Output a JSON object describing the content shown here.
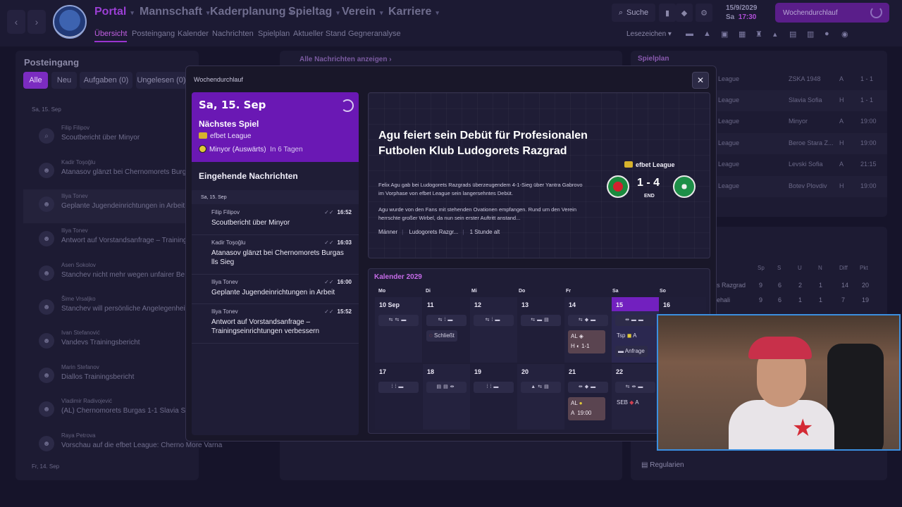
{
  "topbar": {
    "main_nav": [
      {
        "label": "Portal",
        "active": true
      },
      {
        "label": "Mannschaft"
      },
      {
        "label": "Kaderplanung"
      },
      {
        "label": "Spieltag"
      },
      {
        "label": "Verein"
      },
      {
        "label": "Karriere"
      }
    ],
    "sub_nav": [
      "Übersicht",
      "Posteingang",
      "Kalender",
      "Nachrichten",
      "Spielplan",
      "Aktueller Stand",
      "Gegneranalyse"
    ],
    "search_label": "Suche",
    "date": "15/9/2029",
    "day_time": "Sa",
    "time": "17:30",
    "continue_label": "Wochendurchlauf",
    "bookmarks_label": "Lesezeichen"
  },
  "inbox": {
    "title": "Posteingang",
    "filters": [
      "Alle",
      "Neu",
      "Aufgaben (0)",
      "Ungelesen (0)"
    ],
    "date_header": "Sa, 15. Sep",
    "date_header_2": "Fr, 14. Sep",
    "items": [
      {
        "sender": "Filip Filipov",
        "subject": "Scoutbericht über Minyor"
      },
      {
        "sender": "Kadir Toşoğlu",
        "subject": "Atanasov glänzt bei Chernomorets Burgas"
      },
      {
        "sender": "Iliya Tonev",
        "subject": "Geplante Jugendeinrichtungen in Arbeit"
      },
      {
        "sender": "Iliya Tonev",
        "subject": "Antwort auf Vorstandsanfrage – Training"
      },
      {
        "sender": "Asen Sokolov",
        "subject": "Stanchev nicht mehr wegen unfairer Be"
      },
      {
        "sender": "Šime Vrsaljko",
        "subject": "Stanchev will persönliche Angelegenheit"
      },
      {
        "sender": "Ivan Stefanović",
        "subject": "Vandevs Trainingsbericht"
      },
      {
        "sender": "Marin Stefanov",
        "subject": "Diallos Trainingsbericht"
      },
      {
        "sender": "Vladimir Radivojević",
        "subject": "(AL) Chernomorets Burgas 1-1 Slavia Sof"
      },
      {
        "sender": "Raya Petrova",
        "subject": "Vorschau auf die efbet League: Cherno More Varna vs. ZS..."
      }
    ]
  },
  "news_header": "Alle Nachrichten anzeigen",
  "schedule": {
    "title": "Spielplan",
    "rows": [
      {
        "comp": "League",
        "opponent": "ZSKA 1948",
        "venue": "A",
        "result": "1 - 1"
      },
      {
        "comp": "League",
        "opponent": "Slavia Sofia",
        "venue": "H",
        "result": "1 - 1"
      },
      {
        "comp": "League",
        "opponent": "Minyor",
        "venue": "A",
        "result": "19:00"
      },
      {
        "comp": "League",
        "opponent": "Beroe Stara Z...",
        "venue": "H",
        "result": "19:00"
      },
      {
        "comp": "League",
        "opponent": "Levski Sofia",
        "venue": "A",
        "result": "21:15"
      },
      {
        "comp": "League",
        "opponent": "Botev Plovdiv",
        "venue": "H",
        "result": "19:00"
      }
    ]
  },
  "table": {
    "headers": [
      "Sp",
      "S",
      "U",
      "N",
      "Diff",
      "Pkt"
    ],
    "rows": [
      {
        "team": "s Razgrad",
        "values": [
          "9",
          "6",
          "2",
          "1",
          "14",
          "20"
        ]
      },
      {
        "team": "ehali",
        "values": [
          "9",
          "6",
          "1",
          "1",
          "7",
          "19"
        ]
      }
    ]
  },
  "regularien_label": "Regularien",
  "modal": {
    "title": "Wochendurchlauf",
    "next_match": {
      "date": "Sa, 15. Sep",
      "label": "Nächstes Spiel",
      "league": "efbet League",
      "opponent": "Minyor (Auswärts)",
      "days": "In 6 Tagen"
    },
    "incoming_title": "Eingehende Nachrichten",
    "incoming_date": "Sa, 15. Sep",
    "messages": [
      {
        "sender": "Filip Filipov",
        "text": "Scoutbericht über Minyor",
        "time": "16:52"
      },
      {
        "sender": "Kadir Toşoğlu",
        "text": "Atanasov glänzt bei Chernomorets Burgas lls Sieg",
        "time": "16:03"
      },
      {
        "sender": "Iliya Tonev",
        "text": "Geplante Jugendeinrichtungen in Arbeit",
        "time": "16:00"
      },
      {
        "sender": "Iliya Tonev",
        "text": "Antwort auf Vorstandsanfrage – Trainingseinrichtungen verbessern",
        "time": "15:52"
      }
    ],
    "news": {
      "headline": "Agu feiert sein Debüt für Profesionalen Futbolen Klub Ludogorets Razgrad",
      "p1": "Felix Agu gab bei Ludogorets Razgrads überzeugendem 4-1-Sieg über Yantra Gabrovo im Vorphase von efbet League sein langersehntes Debüt.",
      "p2": "Agu wurde von den Fans mit stehenden Ovationen empfangen. Rund um den Verein herrschte großer Wirbel, da nun sein erster Auftritt anstand...",
      "tags": [
        "Männer",
        "Ludogorets Razgr...",
        "1 Stunde alt"
      ],
      "league": "efbet League",
      "score": "1 - 4",
      "status": "END"
    },
    "calendar": {
      "title": "Kalender 2029",
      "dow": [
        "Mo",
        "Di",
        "Mi",
        "Do",
        "Fr",
        "Sa",
        "So"
      ],
      "week1": [
        "10 Sep",
        "11",
        "12",
        "13",
        "14",
        "15",
        "16"
      ],
      "week2": [
        "17",
        "18",
        "19",
        "20",
        "21",
        "22"
      ],
      "tag_closes": "Schließt",
      "tag_inquiry": "Anfrage",
      "match14": {
        "top": "AL",
        "bottom": "H",
        "result": "1-1"
      },
      "match15": {
        "a": "Tsp",
        "b": "A"
      },
      "match21": {
        "top": "AL",
        "bottom": "A",
        "time": "19:00"
      },
      "match22": {
        "a": "SEB",
        "b": "A"
      }
    }
  },
  "colors": {
    "accent": "#7b2cc0",
    "background": "#16142a",
    "panel": "#1d1b33"
  }
}
